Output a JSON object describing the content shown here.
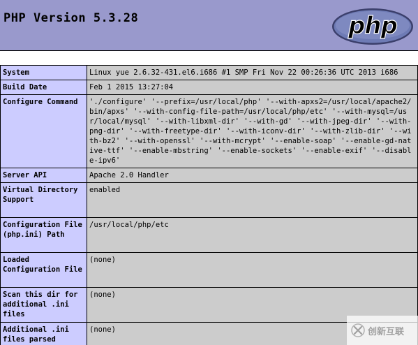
{
  "header": {
    "title": "PHP Version 5.3.28",
    "logo_text": "php",
    "background_color": "#9999cc"
  },
  "colors": {
    "label_cell": "#ccccff",
    "value_cell": "#cccccc"
  },
  "rows": [
    {
      "label": "System",
      "value": "Linux yue 2.6.32-431.el6.i686 #1 SMP Fri Nov 22 00:26:36 UTC 2013 i686"
    },
    {
      "label": "Build Date",
      "value": "Feb 1 2015 13:27:04"
    },
    {
      "label": "Configure Command",
      "value": "'./configure' '--prefix=/usr/local/php' '--with-apxs2=/usr/local/apache2/bin/apxs' '--with-config-file-path=/usr/local/php/etc' '--with-mysql=/usr/local/mysql' '--with-libxml-dir' '--with-gd' '--with-jpeg-dir' '--with-png-dir' '--with-freetype-dir' '--with-iconv-dir' '--with-zlib-dir' '--with-bz2' '--with-openssl' '--with-mcrypt' '--enable-soap' '--enable-gd-native-ttf' '--enable-mbstring' '--enable-sockets' '--enable-exif' '--disable-ipv6'"
    },
    {
      "label": "Server API",
      "value": "Apache 2.0 Handler"
    },
    {
      "label": "Virtual Directory Support",
      "value": "enabled"
    },
    {
      "label": "Configuration File (php.ini) Path",
      "value": "/usr/local/php/etc"
    },
    {
      "label": "Loaded Configuration File",
      "value": "(none)"
    },
    {
      "label": "Scan this dir for additional .ini files",
      "value": "(none)"
    },
    {
      "label": "Additional .ini files parsed",
      "value": "(none)"
    }
  ],
  "watermark": {
    "text": "创新互联",
    "icon": "brand-x-icon"
  }
}
